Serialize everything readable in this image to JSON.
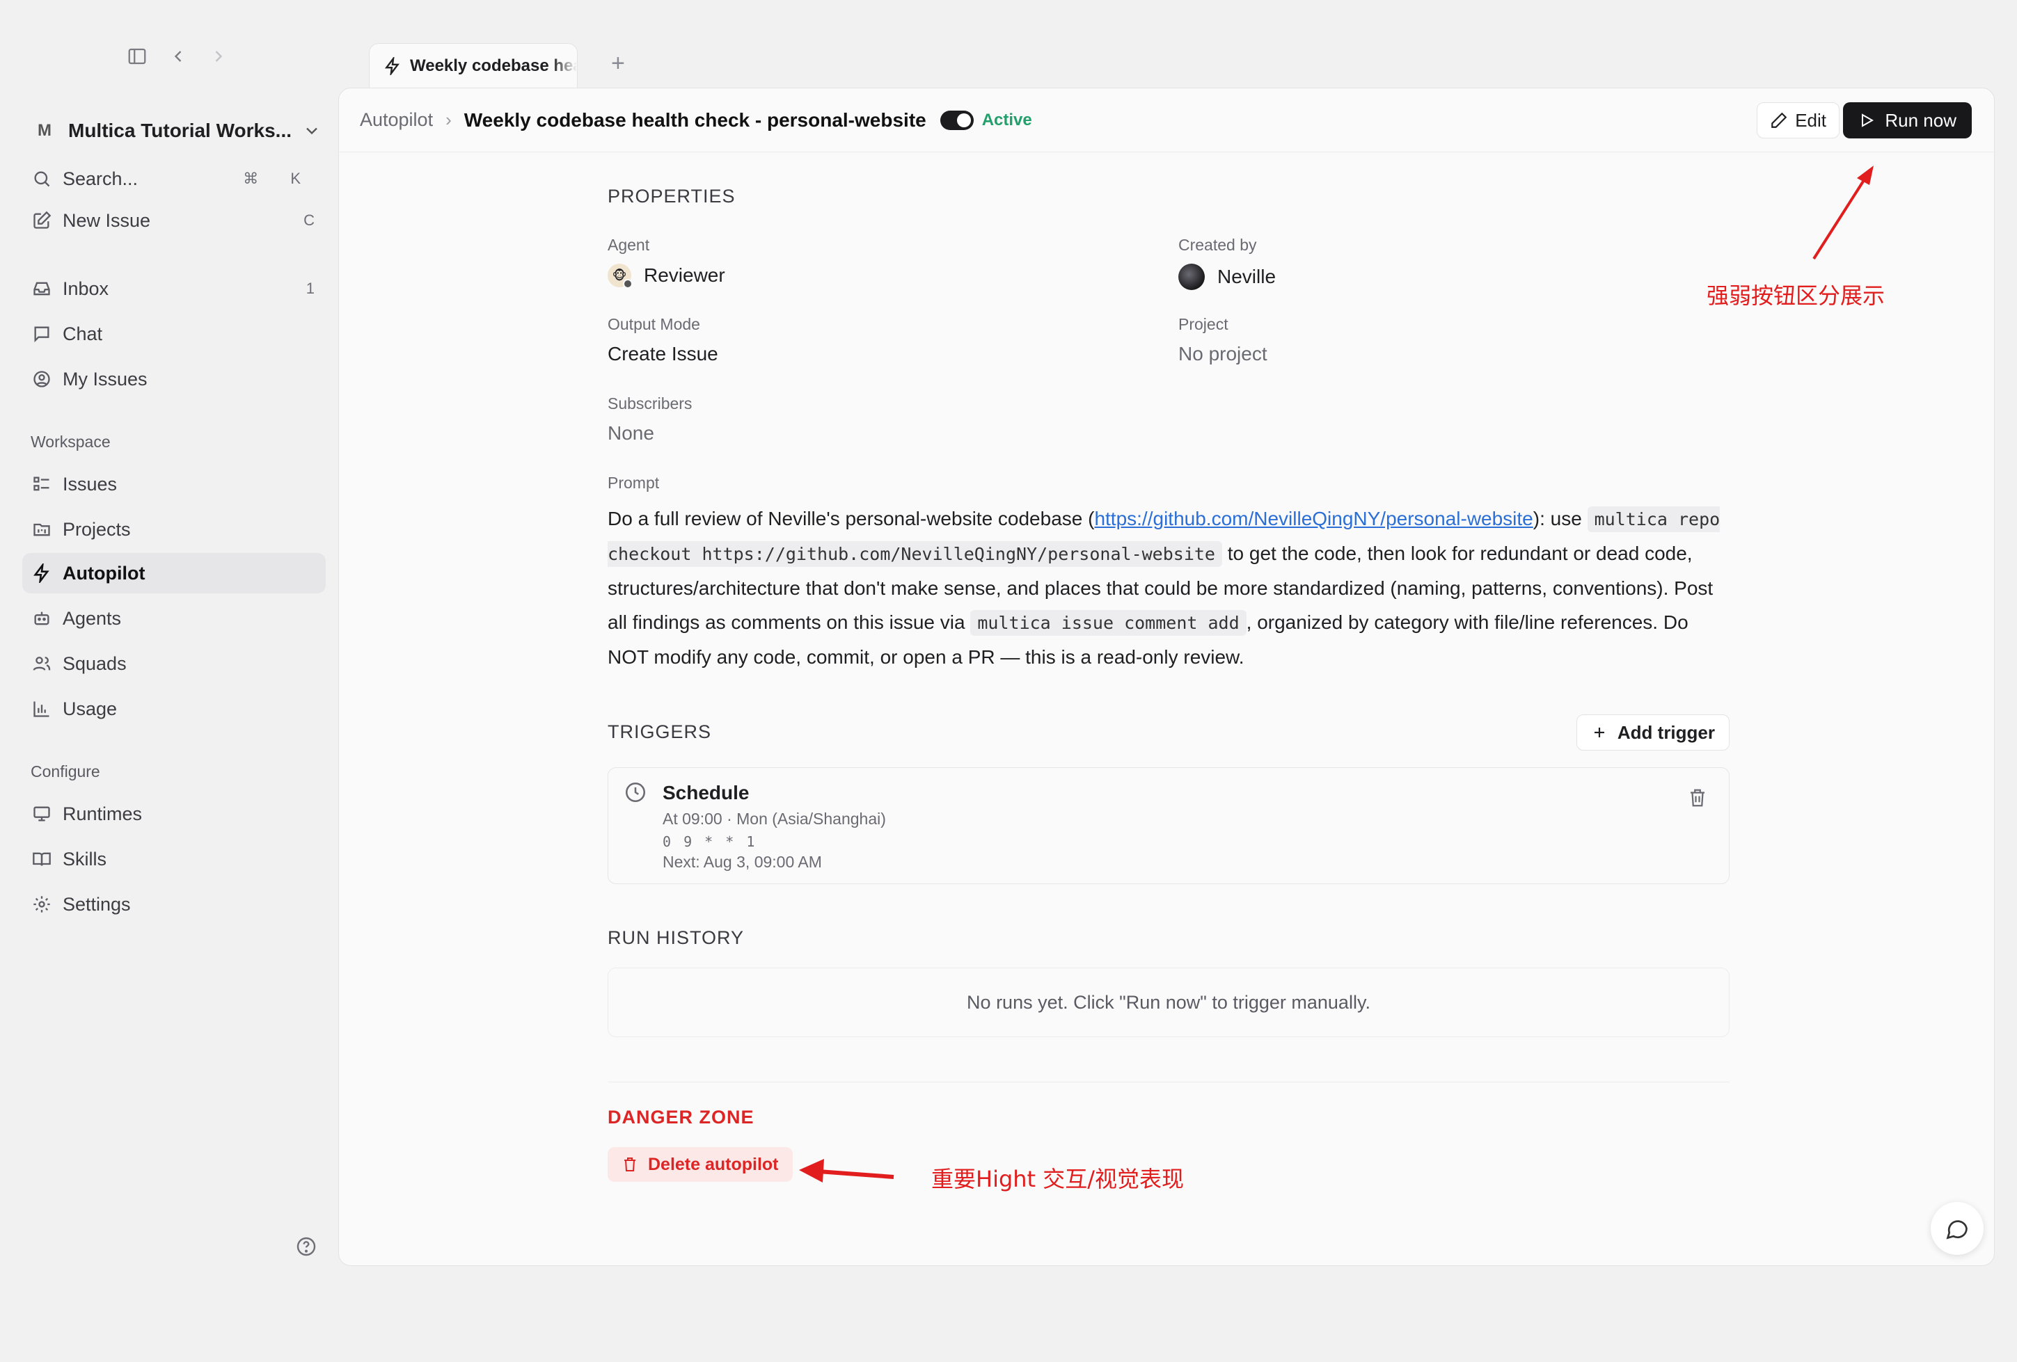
{
  "window": {
    "sidebar_toggle_icon": "sidebar-toggle-icon",
    "back_icon": "chevron-left-icon",
    "forward_icon": "chevron-right-icon"
  },
  "tabs": [
    {
      "label": "Weekly codebase health check - personal-website",
      "icon": "bolt-icon"
    }
  ],
  "tab_add_label": "+",
  "workspace": {
    "badge": "M",
    "name": "Multica Tutorial Works..."
  },
  "sidebar": {
    "search": {
      "label": "Search...",
      "kbd": "⌘ K"
    },
    "new_issue": {
      "label": "New Issue",
      "kbd": "C"
    },
    "inbox": {
      "label": "Inbox",
      "count": "1"
    },
    "chat": {
      "label": "Chat"
    },
    "my_issues": {
      "label": "My Issues"
    },
    "workspace_heading": "Workspace",
    "workspace_items": [
      "Issues",
      "Projects",
      "Autopilot",
      "Agents",
      "Squads",
      "Usage"
    ],
    "configure_heading": "Configure",
    "configure_items": [
      "Runtimes",
      "Skills",
      "Settings"
    ],
    "active": "Autopilot"
  },
  "breadcrumb": {
    "root": "Autopilot",
    "separator": "›",
    "title": "Weekly codebase health check - personal-website"
  },
  "status": {
    "label": "Active",
    "enabled": true,
    "color": "#22a06b"
  },
  "actions": {
    "edit": "Edit",
    "run_now": "Run now"
  },
  "properties": {
    "heading": "PROPERTIES",
    "agent_label": "Agent",
    "agent_value": "Reviewer",
    "created_by_label": "Created by",
    "created_by_value": "Neville",
    "output_mode_label": "Output Mode",
    "output_mode_value": "Create Issue",
    "project_label": "Project",
    "project_value": "No project",
    "subscribers_label": "Subscribers",
    "subscribers_value": "None",
    "prompt_label": "Prompt",
    "prompt": {
      "t1": "Do a full review of Neville's personal-website codebase (",
      "link": "https://github.com/NevilleQingNY/personal-website",
      "t2": "): use ",
      "code1": "multica repo checkout https://github.com/NevilleQingNY/personal-website",
      "t3": " to get the code, then look for redundant or dead code, structures/architecture that don't make sense, and places that could be more standardized (naming, patterns, conventions). Post all findings as comments on this issue via ",
      "code2": "multica issue comment add",
      "t4": ", organized by category with file/line references. Do NOT modify any code, commit, or open a PR — this is a read-only review."
    }
  },
  "triggers": {
    "heading": "TRIGGERS",
    "add_label": "Add trigger",
    "items": [
      {
        "name": "Schedule",
        "detail": "At 09:00 · Mon (Asia/Shanghai)",
        "cron": "0 9 * * 1",
        "next": "Next: Aug 3, 09:00 AM"
      }
    ]
  },
  "run_history": {
    "heading": "RUN HISTORY",
    "empty": "No runs yet. Click \"Run now\" to trigger manually."
  },
  "danger_zone": {
    "heading": "DANGER ZONE",
    "delete_label": "Delete autopilot",
    "color": "#dc2626"
  },
  "annotations": {
    "note1": "强弱按钮区分展示",
    "note2": "重要Hight 交互/视觉表现",
    "color": "#e11d1d"
  }
}
